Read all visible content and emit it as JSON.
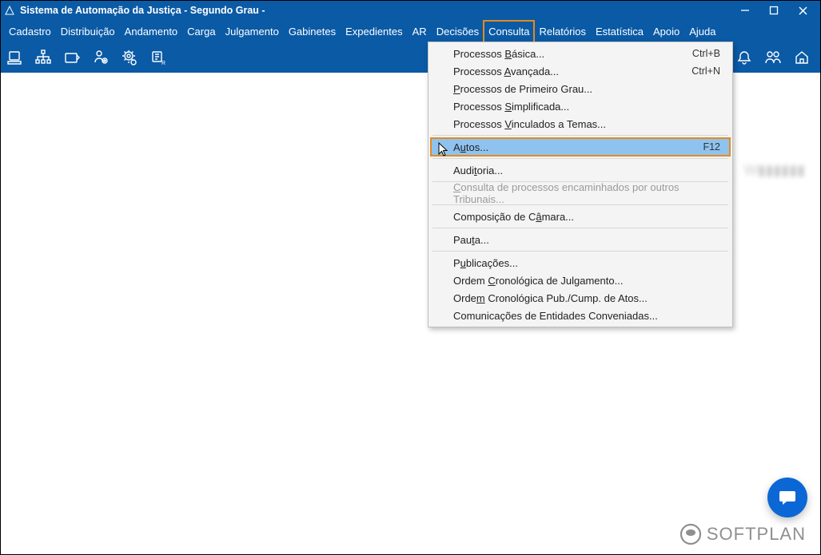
{
  "window": {
    "title": "Sistema de Automação da Justiça - Segundo Grau -"
  },
  "menubar": [
    "Cadastro",
    "Distribuição",
    "Andamento",
    "Carga",
    "Julgamento",
    "Gabinetes",
    "Expedientes",
    "AR",
    "Decisões",
    "Consulta",
    "Relatórios",
    "Estatística",
    "Apoio",
    "Ajuda"
  ],
  "active_menu_index": 9,
  "dropdown": {
    "items": [
      {
        "label": "Processos Básica...",
        "accel": "Ctrl+B",
        "u": 10
      },
      {
        "label": "Processos Avançada...",
        "accel": "Ctrl+N",
        "u": 10
      },
      {
        "label": "Processos de Primeiro Grau...",
        "u": 0
      },
      {
        "label": "Processos Simplificada...",
        "u": 10
      },
      {
        "label": "Processos Vinculados a Temas...",
        "u": 10
      },
      {
        "sep": true
      },
      {
        "label": "Autos...",
        "accel": "F12",
        "selected": true,
        "u": 1
      },
      {
        "sep": true
      },
      {
        "label": "Auditoria...",
        "u": 4
      },
      {
        "sep": true
      },
      {
        "label": "Consulta de processos encaminhados por outros Tribunais...",
        "disabled": true,
        "u": 0
      },
      {
        "sep": true
      },
      {
        "label": "Composição de Câmara...",
        "u": 15
      },
      {
        "sep": true
      },
      {
        "label": "Pauta...",
        "u": 3
      },
      {
        "sep": true
      },
      {
        "label": "Publicações...",
        "u": 1
      },
      {
        "label": "Ordem Cronológica de Julgamento...",
        "u": 6
      },
      {
        "label": "Ordem Cronológica Pub./Cump. de Atos...",
        "u": 4
      },
      {
        "label": "Comunicações de Entidades Conveniadas..."
      }
    ]
  },
  "brand": "SOFTPLAN"
}
